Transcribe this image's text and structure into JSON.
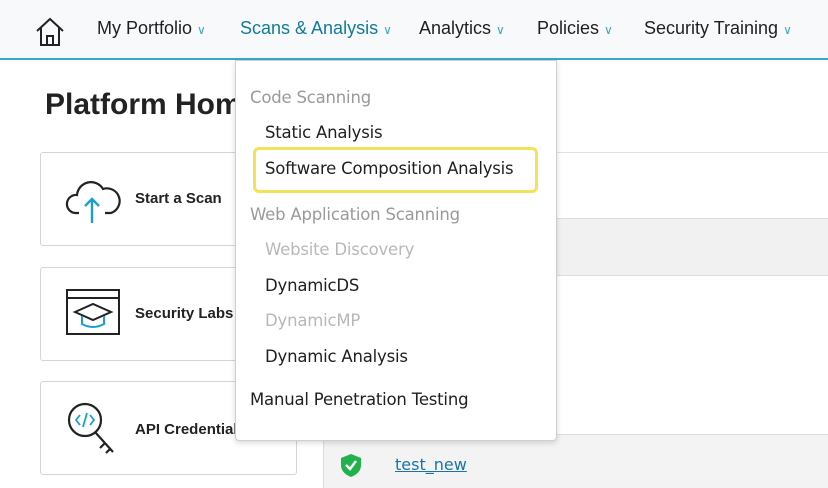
{
  "nav": {
    "items": [
      {
        "label": "My Portfolio"
      },
      {
        "label": "Scans & Analysis"
      },
      {
        "label": "Analytics"
      },
      {
        "label": "Policies"
      },
      {
        "label": "Security Training"
      }
    ],
    "accent": "#3aa8c6"
  },
  "page": {
    "title": "Platform Home"
  },
  "cards": [
    {
      "label": "Start a Scan"
    },
    {
      "label": "Security Labs"
    },
    {
      "label": "API Credentials"
    }
  ],
  "menu": {
    "code_header": "Code Scanning",
    "static": "Static Analysis",
    "sca": "Software Composition Analysis",
    "web_header": "Web Application Scanning",
    "discovery": "Website Discovery",
    "dynamicds": "DynamicDS",
    "dynamicmp": "DynamicMP",
    "dynamic": "Dynamic Analysis",
    "manual": "Manual Penetration Testing",
    "highlight_color": "#f3e25a"
  },
  "table": {
    "row_link": "test_new"
  }
}
